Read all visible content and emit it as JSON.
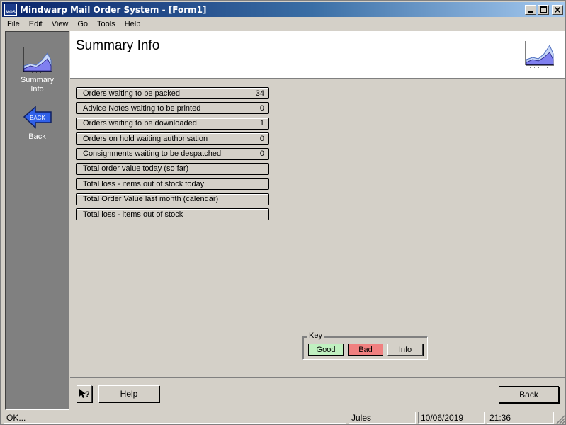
{
  "window": {
    "title": "Mindwarp Mail Order System - [Form1]",
    "app_icon_text": "MOS"
  },
  "menu": [
    "File",
    "Edit",
    "View",
    "Go",
    "Tools",
    "Help"
  ],
  "nav": {
    "summary_label": "Summary Info",
    "back_icon_text": "BACK",
    "back_label": "Back"
  },
  "header": {
    "title": "Summary Info"
  },
  "status_rows": [
    {
      "label": "Orders waiting to be packed",
      "value": "34"
    },
    {
      "label": "Advice Notes waiting to be printed",
      "value": "0"
    },
    {
      "label": "Orders waiting to be downloaded",
      "value": "1"
    },
    {
      "label": "Orders on hold waiting authorisation",
      "value": "0"
    },
    {
      "label": "Consignments waiting to be despatched",
      "value": "0"
    },
    {
      "label": "Total order value today (so far)",
      "value": ""
    },
    {
      "label": "Total loss - items out of stock today",
      "value": ""
    },
    {
      "label": "Total Order Value last month (calendar)",
      "value": ""
    },
    {
      "label": "Total loss - items out of stock",
      "value": ""
    }
  ],
  "key": {
    "title": "Key",
    "good": "Good",
    "bad": "Bad",
    "info": "Info",
    "good_color": "#c0f0c0",
    "bad_color": "#f08080"
  },
  "footer": {
    "help_label": "Help",
    "back_label": "Back"
  },
  "statusbar": {
    "message": "OK...",
    "user": "Jules",
    "date": "10/06/2019",
    "time": "21:36"
  },
  "colors": {
    "titlebar_start": "#0a246a",
    "titlebar_end": "#a6caf0",
    "nav_background": "#808080",
    "face": "#d4d0c8"
  }
}
